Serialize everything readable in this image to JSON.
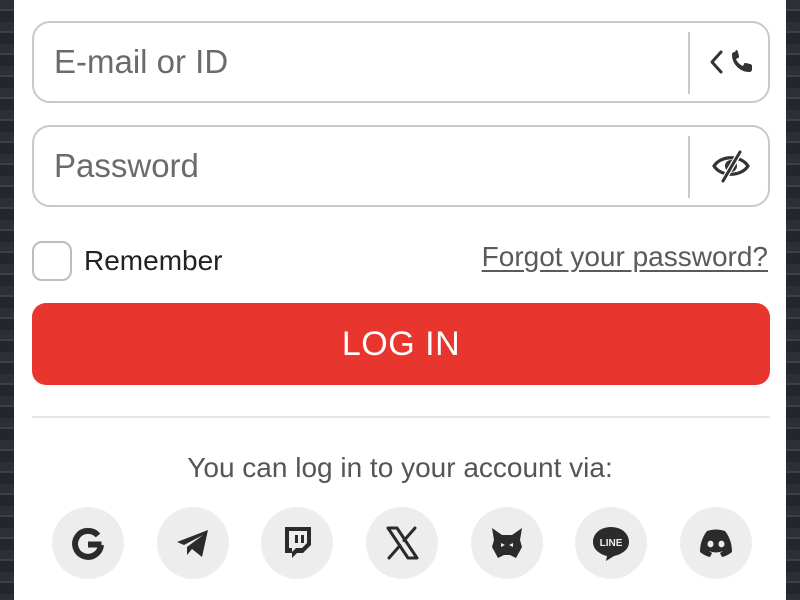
{
  "login": {
    "email_placeholder": "E-mail or ID",
    "password_placeholder": "Password",
    "remember_label": "Remember",
    "forgot_label": "Forgot your password?",
    "login_label": "LOG IN",
    "via_text": "You can log in to your account via:"
  },
  "social": [
    {
      "icon": "google-icon"
    },
    {
      "icon": "telegram-icon"
    },
    {
      "icon": "twitch-icon"
    },
    {
      "icon": "x-icon"
    },
    {
      "icon": "metamask-icon"
    },
    {
      "icon": "line-icon",
      "text": "LINE"
    },
    {
      "icon": "discord-icon"
    }
  ],
  "colors": {
    "accent": "#e8362f",
    "icon": "#333333",
    "field_border": "#c9c9c9",
    "social_bg": "#ededed"
  }
}
